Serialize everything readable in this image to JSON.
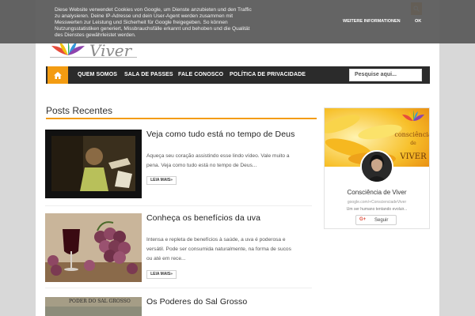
{
  "brand": {
    "logo_text": "Viver",
    "accent_color": "#f39c12",
    "nav_bg_color": "#2b2b2b"
  },
  "cookie_bar": {
    "text": "Diese Website verwendet Cookies von Google, um Dienste anzubieten und den Traffic zu analysieren. Deine IP-Adresse und dein User-Agent werden zusammen mit Messwerten zur Leistung und Sicherheit für Google freigegeben. So können Nutzungsstatistiken generiert, Missbrauchsfälle erkannt und behoben und die Qualität des Dienstes gewährleistet werden.",
    "more_label": "WEITERE INFORMATIONEN",
    "ok_label": "OK"
  },
  "nav": {
    "home_icon": "home-icon",
    "items": [
      {
        "label": "QUEM SOMOS"
      },
      {
        "label": "SALA DE PASSES"
      },
      {
        "label": "FALE CONOSCO"
      },
      {
        "label": "POLÍTICA DE PRIVACIDADE"
      }
    ],
    "search_placeholder": "Pesquise aqui...",
    "search_icon": "search-icon"
  },
  "main": {
    "section_title": "Posts Recentes",
    "posts": [
      {
        "title": "Veja como tudo está no tempo de Deus",
        "excerpt": "Aqueça seu coração assistindo esse lindo vídeo. Vale muito a pena.  Veja como tudo está no tempo de Deus...",
        "button": "LEIA MAIS»"
      },
      {
        "title": "Conheça os benefícios da uva",
        "excerpt": "Intensa e repleta de benefícios à saúde, a uva é poderosa e versátil. Pode ser consumida naturalmente, na forma de sucos ou até em rece...",
        "button": "LEIA MAIS»"
      },
      {
        "title": "Os Poderes do Sal Grosso",
        "thumb_caption": "PODER DO SAL GROSSO"
      }
    ]
  },
  "sidebar": {
    "cover_text_1": "consciência",
    "cover_text_2": "de",
    "cover_text_3": "VIVER",
    "name": "Consciência de Viver",
    "url": "google.com/+ConscienciadeViver",
    "tagline": "Um ser humano tentando evoluir...",
    "follow_label": "Seguir",
    "gplus_icon": "G+"
  }
}
